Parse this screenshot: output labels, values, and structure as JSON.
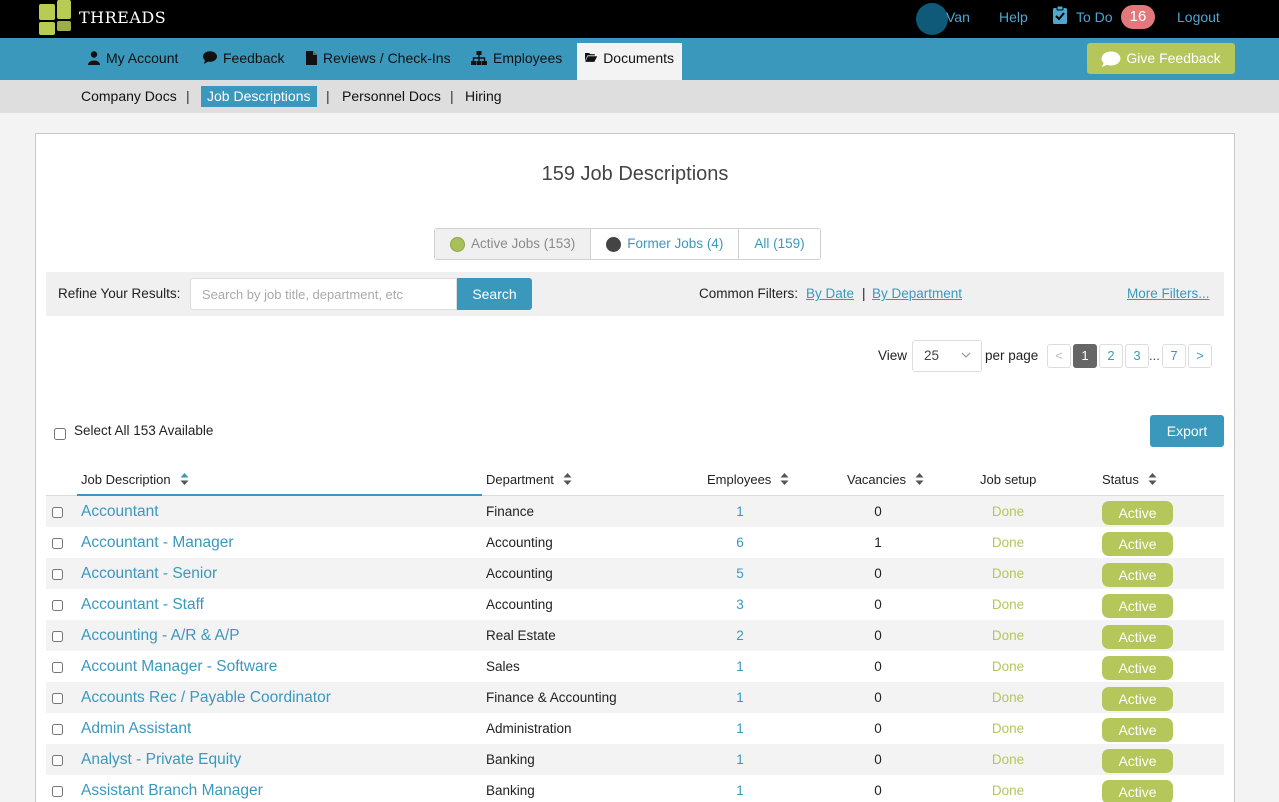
{
  "header": {
    "brand": "THREADS",
    "user": "Van",
    "help": "Help",
    "todo_label": "To Do",
    "todo_count": "16",
    "logout": "Logout"
  },
  "nav": {
    "items": [
      {
        "label": "My Account",
        "icon": "user-icon"
      },
      {
        "label": "Feedback",
        "icon": "comment-icon"
      },
      {
        "label": "Reviews / Check-Ins",
        "icon": "file-icon"
      },
      {
        "label": "Employees",
        "icon": "org-chart-icon"
      },
      {
        "label": "Documents",
        "icon": "folder-open-icon",
        "active": true
      }
    ],
    "give_feedback": "Give Feedback"
  },
  "subnav": {
    "items": [
      "Company Docs",
      "Job Descriptions",
      "Personnel Docs",
      "Hiring"
    ],
    "active": "Job Descriptions",
    "separator": "|"
  },
  "main": {
    "title": "159 Job Descriptions",
    "tabs": [
      {
        "label": "Active Jobs (153)",
        "dot_color": "#a9bf5a"
      },
      {
        "label": "Former Jobs (4)",
        "dot_color": "#444444"
      },
      {
        "label": "All (159)"
      }
    ],
    "refine": {
      "label": "Refine Your Results:",
      "placeholder": "Search by job title, department, etc",
      "search_button": "Search",
      "common_label": "Common Filters:",
      "by_date": "By Date",
      "separator": "|",
      "by_department": "By Department",
      "more_filters": "More Filters..."
    },
    "pagination": {
      "view_label": "View",
      "per_page_value": "25",
      "per_page_label": "per page",
      "prev": "<",
      "pages": [
        "1",
        "2",
        "3"
      ],
      "ellipsis": "...",
      "last": "7",
      "next": ">",
      "current": "1"
    },
    "select_all": "Select All 153 Available",
    "export": "Export",
    "columns": [
      "Job Description",
      "Department",
      "Employees",
      "Vacancies",
      "Job setup",
      "Status"
    ],
    "rows": [
      {
        "title": "Accountant",
        "department": "Finance",
        "employees": "1",
        "vacancies": "0",
        "setup": "Done",
        "status": "Active"
      },
      {
        "title": "Accountant - Manager",
        "department": "Accounting",
        "employees": "6",
        "vacancies": "1",
        "setup": "Done",
        "status": "Active"
      },
      {
        "title": "Accountant - Senior",
        "department": "Accounting",
        "employees": "5",
        "vacancies": "0",
        "setup": "Done",
        "status": "Active"
      },
      {
        "title": "Accountant - Staff",
        "department": "Accounting",
        "employees": "3",
        "vacancies": "0",
        "setup": "Done",
        "status": "Active"
      },
      {
        "title": "Accounting - A/R & A/P",
        "department": "Real Estate",
        "employees": "2",
        "vacancies": "0",
        "setup": "Done",
        "status": "Active"
      },
      {
        "title": "Account Manager - Software",
        "department": "Sales",
        "employees": "1",
        "vacancies": "0",
        "setup": "Done",
        "status": "Active"
      },
      {
        "title": "Accounts Rec / Payable Coordinator",
        "department": "Finance & Accounting",
        "employees": "1",
        "vacancies": "0",
        "setup": "Done",
        "status": "Active"
      },
      {
        "title": "Admin Assistant",
        "department": "Administration",
        "employees": "1",
        "vacancies": "0",
        "setup": "Done",
        "status": "Active"
      },
      {
        "title": "Analyst - Private Equity",
        "department": "Banking",
        "employees": "1",
        "vacancies": "0",
        "setup": "Done",
        "status": "Active"
      },
      {
        "title": "Assistant Branch Manager",
        "department": "Banking",
        "employees": "1",
        "vacancies": "0",
        "setup": "Done",
        "status": "Active"
      }
    ]
  },
  "colors": {
    "accent": "#3b98bd",
    "green": "#b5c65a",
    "badge": "#e2787c"
  }
}
